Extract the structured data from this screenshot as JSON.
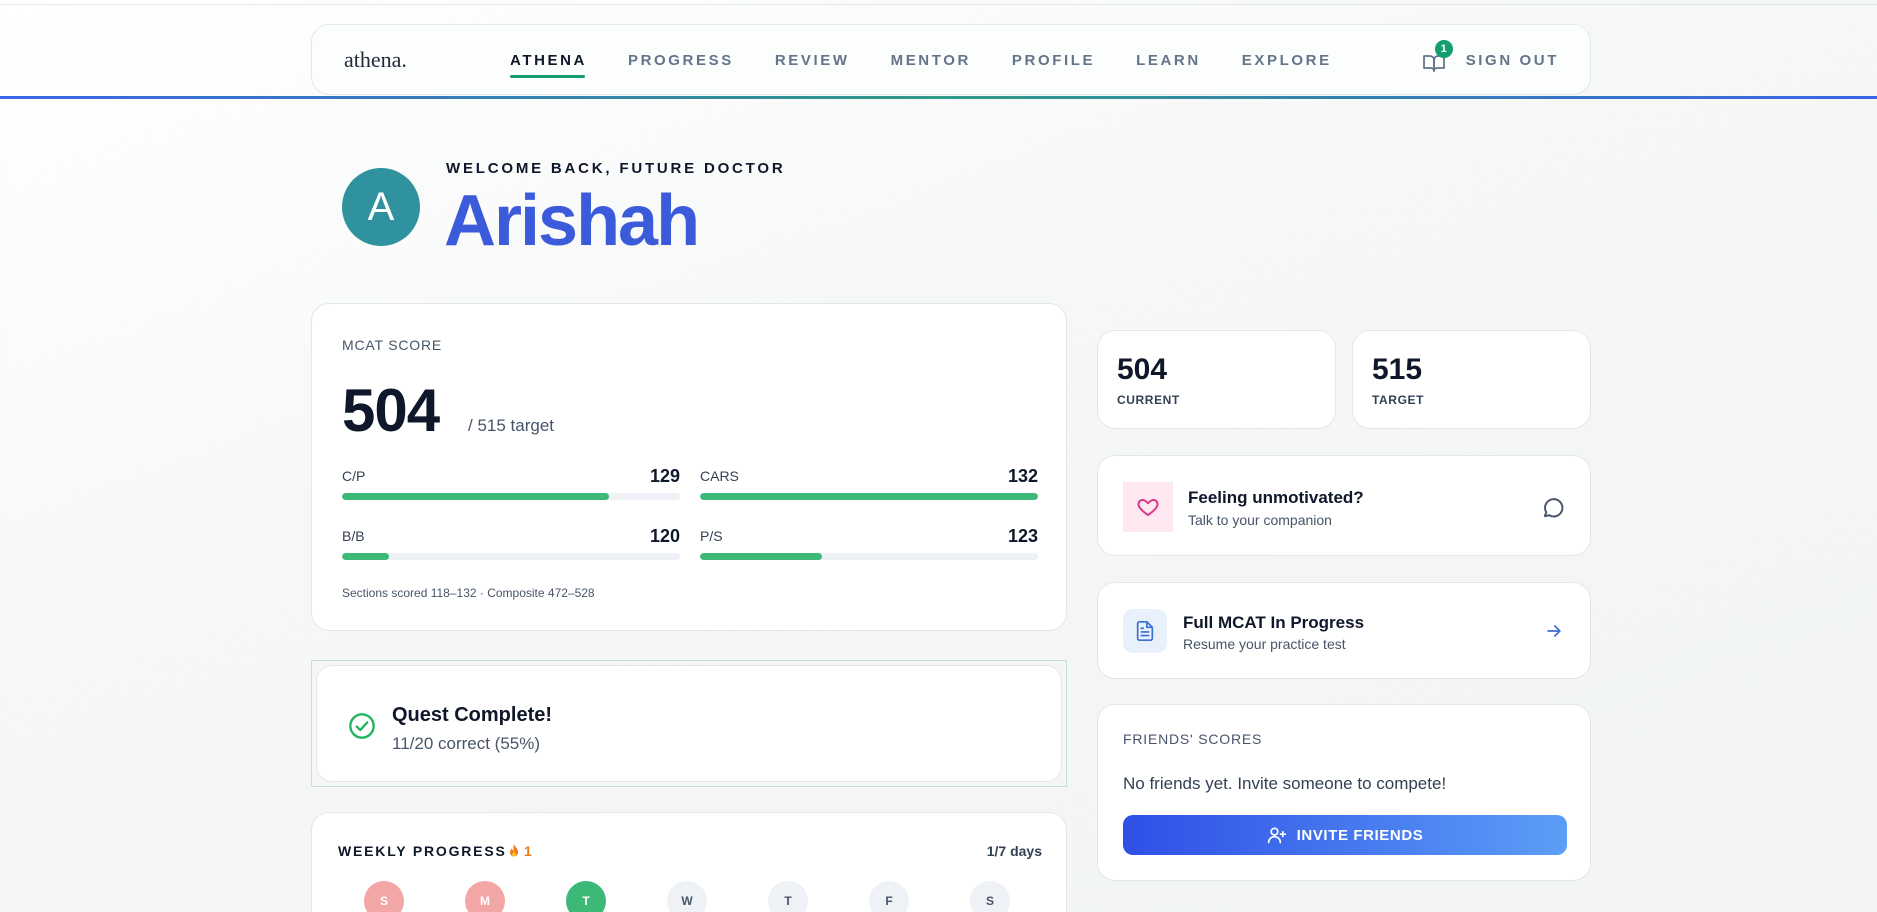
{
  "nav": {
    "logo": "athena.",
    "links": [
      "ATHENA",
      "PROGRESS",
      "REVIEW",
      "MENTOR",
      "PROFILE",
      "LEARN",
      "EXPLORE"
    ],
    "notification_count": "1",
    "sign_out": "SIGN OUT"
  },
  "hero": {
    "avatar_initial": "A",
    "welcome": "WELCOME BACK, FUTURE DOCTOR",
    "name": "Arishah"
  },
  "mcat": {
    "title": "MCAT SCORE",
    "score": "504",
    "target": "/ 515 target",
    "sections": [
      {
        "name": "C/P",
        "value": "129",
        "progress": 0.79
      },
      {
        "name": "CARS",
        "value": "132",
        "progress": 1.0
      },
      {
        "name": "B/B",
        "value": "120",
        "progress": 0.14
      },
      {
        "name": "P/S",
        "value": "123",
        "progress": 0.36
      }
    ],
    "footnote": "Sections scored 118–132 · Composite 472–528"
  },
  "quest": {
    "title": "Quest Complete!",
    "subtitle": "11/20 correct (55%)"
  },
  "weekly": {
    "title": "WEEKLY PROGRESS",
    "streak": "1",
    "days_count": "1/7 days",
    "days": [
      {
        "label": "S",
        "state": "missed"
      },
      {
        "label": "M",
        "state": "missed"
      },
      {
        "label": "T",
        "state": "done"
      },
      {
        "label": "W",
        "state": "upcoming"
      },
      {
        "label": "T",
        "state": "upcoming"
      },
      {
        "label": "F",
        "state": "upcoming"
      },
      {
        "label": "S",
        "state": "upcoming"
      }
    ]
  },
  "stats": {
    "current_value": "504",
    "current_label": "CURRENT",
    "target_value": "515",
    "target_label": "TARGET"
  },
  "motivation": {
    "title": "Feeling unmotivated?",
    "subtitle": "Talk to your companion"
  },
  "full_mcat": {
    "title": "Full MCAT In Progress",
    "subtitle": "Resume your practice test"
  },
  "friends": {
    "title": "FRIENDS' SCORES",
    "empty": "No friends yet. Invite someone to compete!",
    "invite_label": "INVITE FRIENDS"
  },
  "colors": {
    "accent_blue": "#3b5bdb",
    "accent_green": "#149e6d",
    "bar_green": "#3cb877",
    "missed_red": "#f2a6a6",
    "streak_orange": "#ea7a14"
  }
}
